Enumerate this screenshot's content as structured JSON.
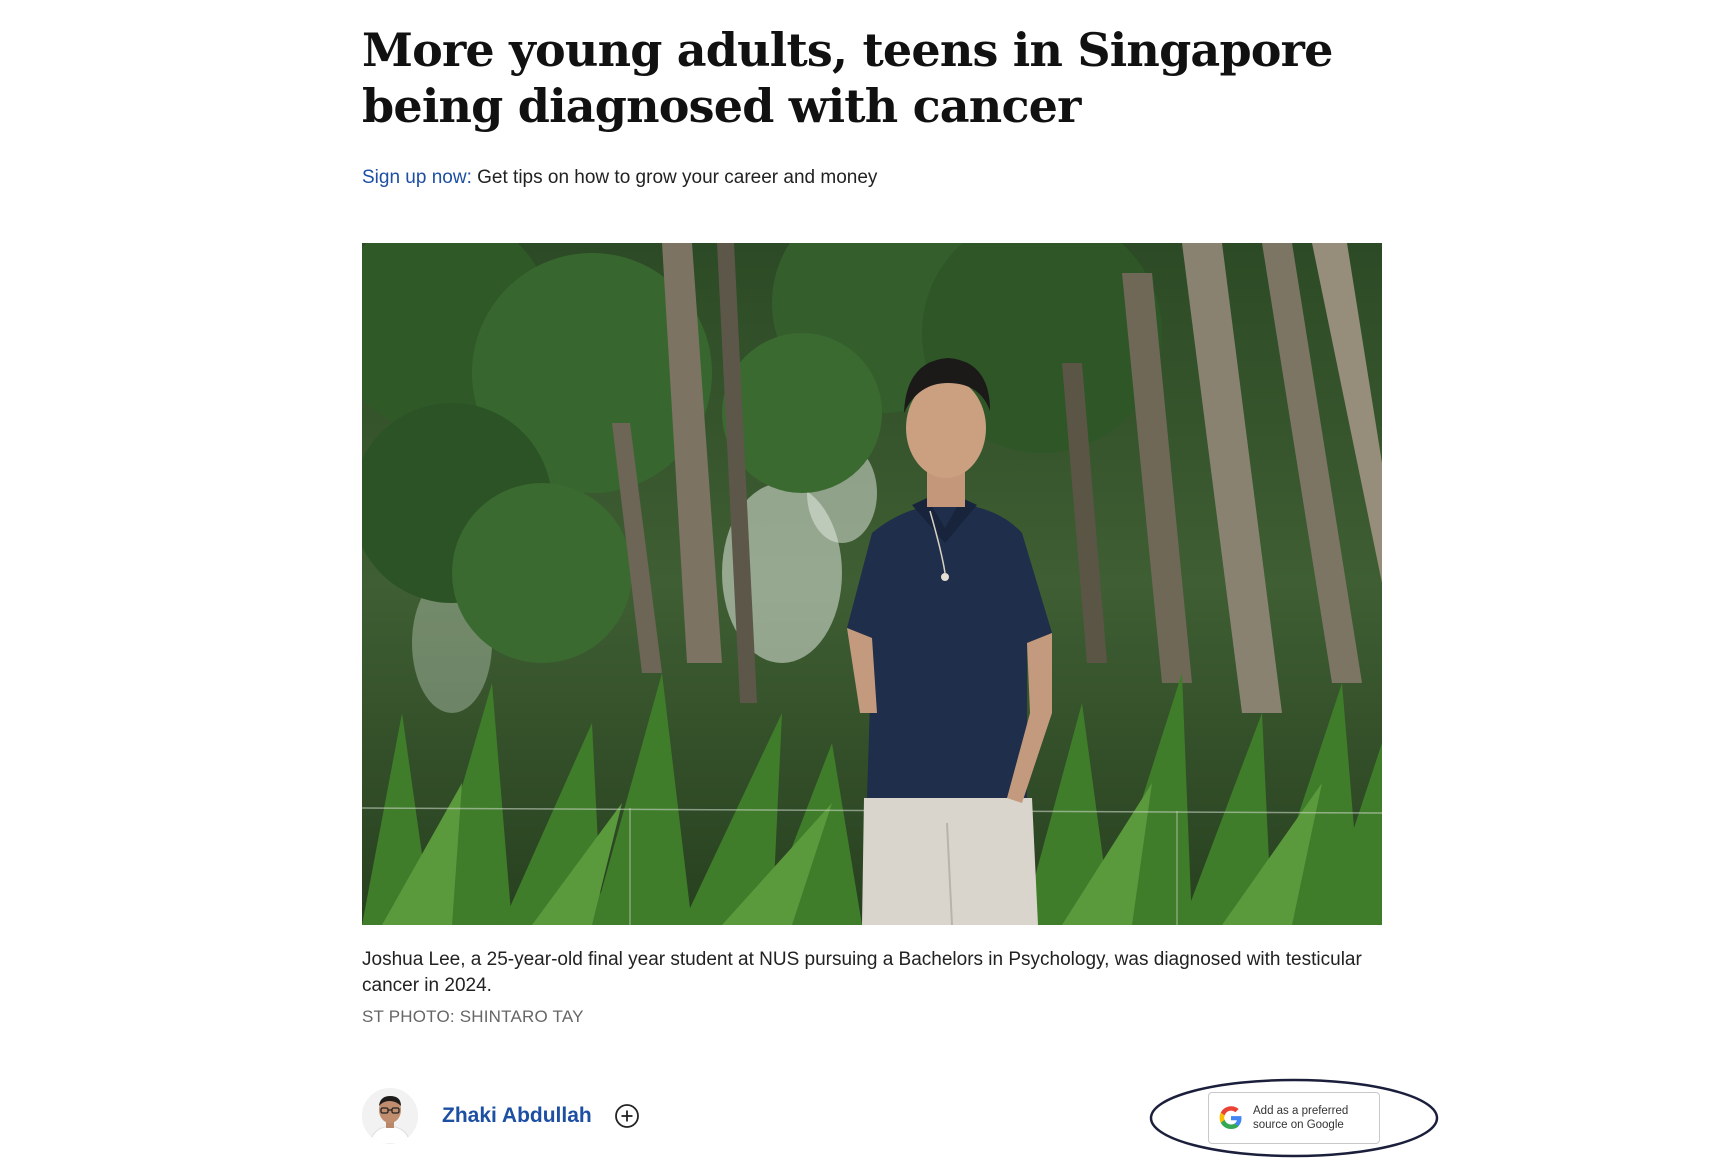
{
  "article": {
    "headline": "More young adults, teens in Singapore being diagnosed with cancer",
    "signup": {
      "link_label": "Sign up now:",
      "text": " Get tips on how to grow your career and money"
    },
    "caption": "Joshua Lee, a 25-year-old final year student at NUS pursuing a Bachelors in Psychology, was diagnosed with testicular cancer in 2024.",
    "credit": "ST PHOTO: SHINTARO TAY",
    "author": {
      "name": "Zhaki Abdullah",
      "follow_icon": "plus-circle-icon"
    },
    "google_source": {
      "label": "Add as a preferred source on Google",
      "icon": "google-g-icon"
    }
  },
  "colors": {
    "link": "#1d4fa3",
    "headline": "#111111",
    "credit": "#666666",
    "oval": "#1b1f3b"
  }
}
